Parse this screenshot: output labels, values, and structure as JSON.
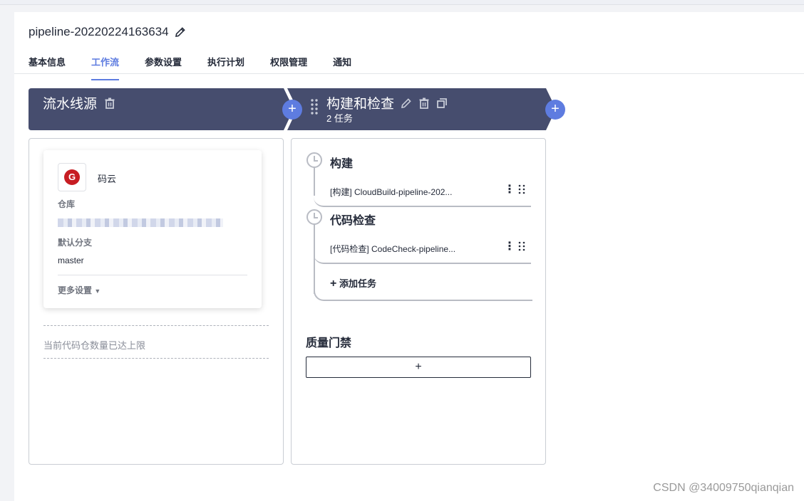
{
  "header": {
    "title": "pipeline-20220224163634",
    "edit_icon": "pencil-icon"
  },
  "tabs": [
    {
      "label": "基本信息",
      "active": false
    },
    {
      "label": "工作流",
      "active": true
    },
    {
      "label": "参数设置",
      "active": false
    },
    {
      "label": "执行计划",
      "active": false
    },
    {
      "label": "权限管理",
      "active": false
    },
    {
      "label": "通知",
      "active": false
    }
  ],
  "colors": {
    "accent": "#5e7ce0",
    "stage_header": "#464d6e",
    "logo_red": "#c71d23"
  },
  "stages": {
    "source": {
      "title": "流水线源",
      "delete_icon": "trash-icon"
    },
    "build": {
      "title": "构建和检查",
      "subtitle": "2 任务",
      "icons": [
        "pencil-icon",
        "trash-icon",
        "copy-icon"
      ]
    },
    "add_icon": "+"
  },
  "source_card": {
    "name": "码云",
    "logo_letter": "G",
    "repo_label": "仓库",
    "branch_label": "默认分支",
    "branch_value": "master",
    "more_settings": "更多设置",
    "limit_text": "当前代码仓数量已达上限"
  },
  "jobs": [
    {
      "title": "构建",
      "task": "[构建] CloudBuild-pipeline-202..."
    },
    {
      "title": "代码检查",
      "task": "[代码检查] CodeCheck-pipeline..."
    }
  ],
  "add_task": "添加任务",
  "add_task_icon": "+",
  "quality_gate": {
    "title": "质量门禁",
    "add_icon": "+"
  },
  "kebab_icon": "⋮",
  "watermark": "CSDN @34009750qianqian"
}
